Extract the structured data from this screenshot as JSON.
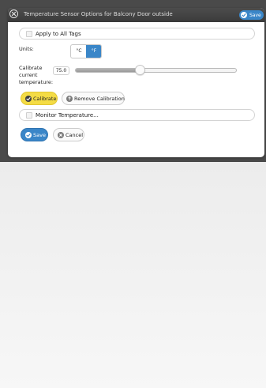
{
  "dialog": {
    "title": "Temperature Sensor Options for Balcony Door outside",
    "save_label": "Save"
  },
  "apply_all": {
    "label": "Apply to All Tags",
    "checked": false
  },
  "units": {
    "label": "Units:",
    "options": [
      "°C",
      "°F"
    ],
    "selected": "°F"
  },
  "calibrate": {
    "label_line1": "Calibrate",
    "label_line2": "current",
    "label_line3": "temperature:",
    "value": "75.0",
    "slider_fraction": 0.4,
    "calibrate_button": "Calibrate",
    "remove_button": "Remove Calibration"
  },
  "monitor": {
    "label": "Monitor Temperature...",
    "checked": false
  },
  "footer": {
    "save_label": "Save",
    "cancel_label": "Cancel"
  },
  "colors": {
    "accent_blue": "#3a86c8",
    "calibrate_yellow": "#f4dc45",
    "titlebar_dark": "#434343"
  },
  "icons": {
    "close": "close-circle-icon",
    "check": "check-icon",
    "help": "question-icon",
    "cancel": "cancel-x-icon"
  }
}
